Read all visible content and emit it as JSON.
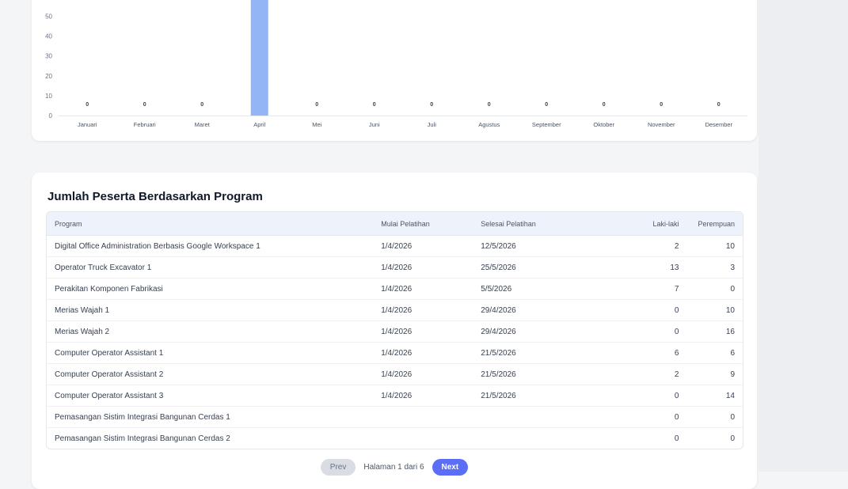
{
  "chart_data": {
    "type": "bar",
    "categories": [
      "Januari",
      "Februari",
      "Maret",
      "April",
      "Mei",
      "Juni",
      "Juli",
      "Agustus",
      "September",
      "Oktober",
      "November",
      "Desember"
    ],
    "values": [
      0,
      0,
      0,
      81,
      0,
      0,
      0,
      0,
      0,
      0,
      0,
      0
    ],
    "data_labels": [
      "0",
      "0",
      "0",
      "",
      "0",
      "0",
      "0",
      "0",
      "0",
      "0",
      "0",
      "0"
    ],
    "y_ticks": [
      "0",
      "10",
      "20",
      "30",
      "40",
      "50"
    ],
    "ylim": [
      0,
      55
    ],
    "bar_color": "#93b4f5",
    "grid": false
  },
  "table_section": {
    "title": "Jumlah Peserta Berdasarkan Program",
    "headers": {
      "program": "Program",
      "mulai": "Mulai Pelatihan",
      "selesai": "Selesai Pelatihan",
      "laki": "Laki-laki",
      "perempuan": "Perempuan"
    },
    "rows": [
      {
        "program": "Digital Office Administration Berbasis Google Workspace 1",
        "mulai": "1/4/2026",
        "selesai": "12/5/2026",
        "laki": "2",
        "perempuan": "10"
      },
      {
        "program": "Operator Truck Excavator 1",
        "mulai": "1/4/2026",
        "selesai": "25/5/2026",
        "laki": "13",
        "perempuan": "3"
      },
      {
        "program": "Perakitan Komponen Fabrikasi",
        "mulai": "1/4/2026",
        "selesai": "5/5/2026",
        "laki": "7",
        "perempuan": "0"
      },
      {
        "program": "Merias Wajah 1",
        "mulai": "1/4/2026",
        "selesai": "29/4/2026",
        "laki": "0",
        "perempuan": "10"
      },
      {
        "program": "Merias Wajah 2",
        "mulai": "1/4/2026",
        "selesai": "29/4/2026",
        "laki": "0",
        "perempuan": "16"
      },
      {
        "program": "Computer Operator Assistant 1",
        "mulai": "1/4/2026",
        "selesai": "21/5/2026",
        "laki": "6",
        "perempuan": "6"
      },
      {
        "program": "Computer Operator Assistant 2",
        "mulai": "1/4/2026",
        "selesai": "21/5/2026",
        "laki": "2",
        "perempuan": "9"
      },
      {
        "program": "Computer Operator Assistant 3",
        "mulai": "1/4/2026",
        "selesai": "21/5/2026",
        "laki": "0",
        "perempuan": "14"
      },
      {
        "program": "Pemasangan Sistim Integrasi Bangunan Cerdas 1",
        "mulai": "",
        "selesai": "",
        "laki": "0",
        "perempuan": "0"
      },
      {
        "program": "Pemasangan Sistim Integrasi Bangunan Cerdas 2",
        "mulai": "",
        "selesai": "",
        "laki": "0",
        "perempuan": "0"
      }
    ]
  },
  "pagination": {
    "prev_label": "Prev",
    "info": "Halaman 1 dari 6",
    "next_label": "Next"
  }
}
